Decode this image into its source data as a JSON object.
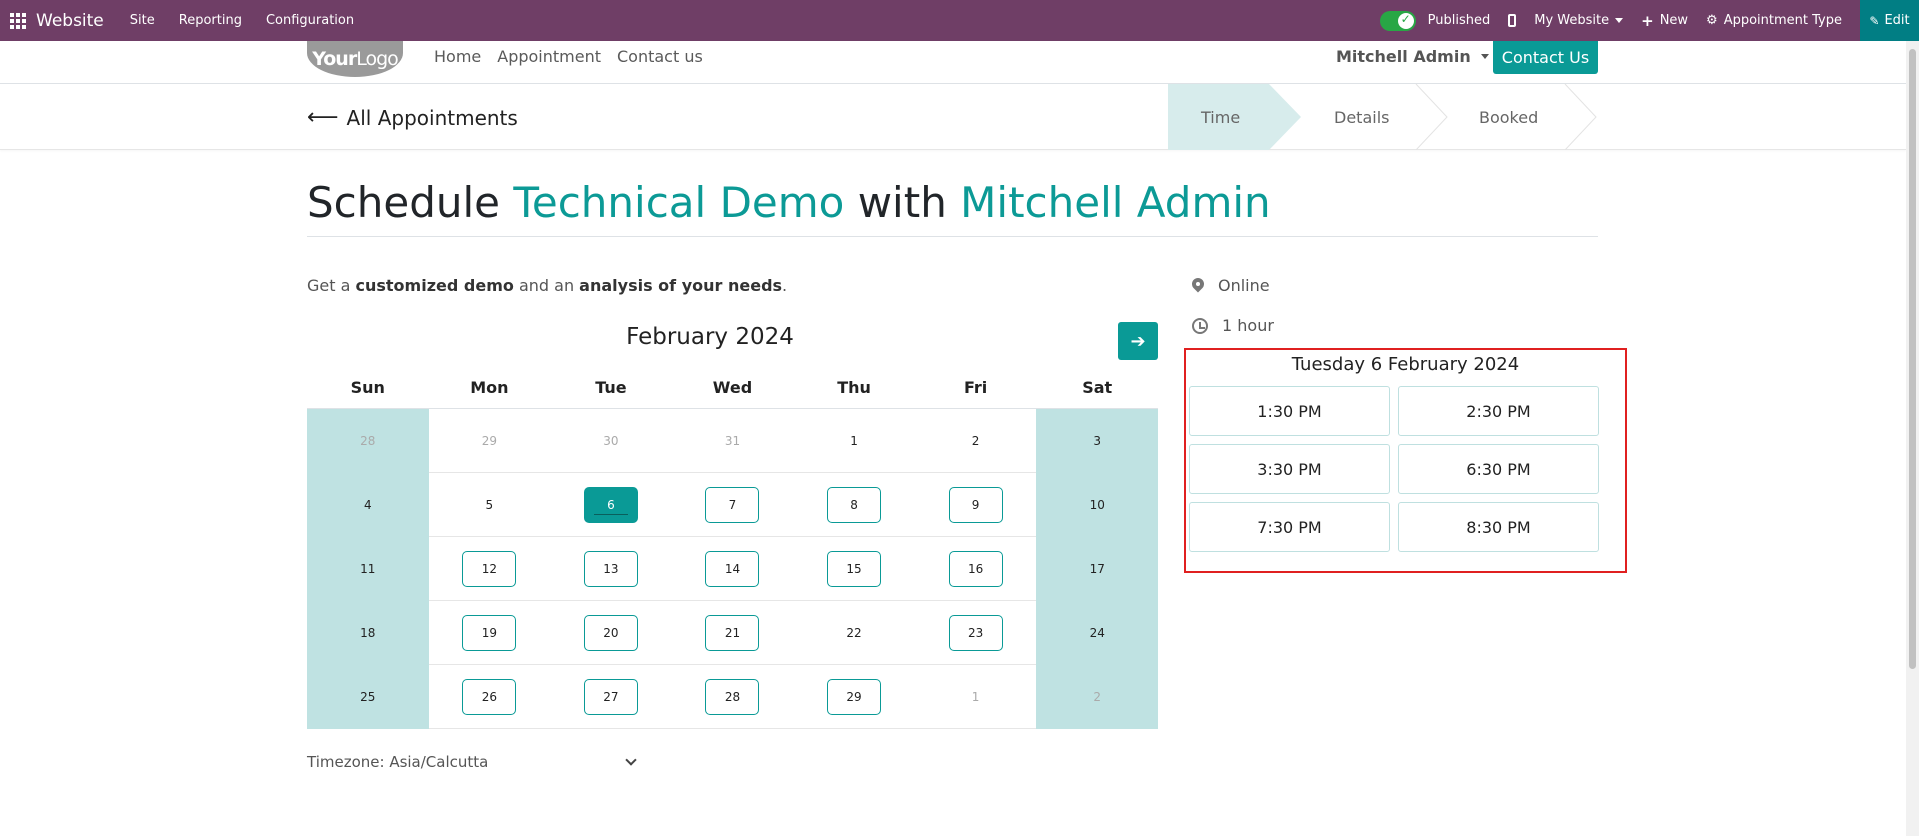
{
  "topbar": {
    "brand": "Website",
    "menus": [
      "Site",
      "Reporting",
      "Configuration"
    ],
    "published": "Published",
    "my_website": "My Website",
    "new": "New",
    "appointment_type": "Appointment Type",
    "edit": "Edit"
  },
  "header": {
    "logo_bold": "Your",
    "logo_light": "Logo",
    "nav": [
      "Home",
      "Appointment",
      "Contact us"
    ],
    "user": "Mitchell Admin",
    "contact_button": "Contact Us"
  },
  "subheader": {
    "back_label": "All Appointments",
    "steps": [
      "Time",
      "Details",
      "Booked"
    ],
    "active_step": 0
  },
  "main": {
    "title_prefix": "Schedule ",
    "title_type": "Technical Demo",
    "title_mid": " with ",
    "title_user": "Mitchell Admin",
    "desc_1": "Get a ",
    "desc_b1": "customized demo",
    "desc_2": " and an ",
    "desc_b2": "analysis of your needs",
    "desc_3": "."
  },
  "calendar": {
    "month": "February 2024",
    "weekdays": [
      "Sun",
      "Mon",
      "Tue",
      "Wed",
      "Thu",
      "Fri",
      "Sat"
    ],
    "weeks": [
      [
        {
          "d": "28",
          "m": true
        },
        {
          "d": "29",
          "m": true
        },
        {
          "d": "30",
          "m": true
        },
        {
          "d": "31",
          "m": true
        },
        {
          "d": "1"
        },
        {
          "d": "2"
        },
        {
          "d": "3"
        }
      ],
      [
        {
          "d": "4"
        },
        {
          "d": "5"
        },
        {
          "d": "6",
          "s": true
        },
        {
          "d": "7",
          "a": true
        },
        {
          "d": "8",
          "a": true
        },
        {
          "d": "9",
          "a": true
        },
        {
          "d": "10"
        }
      ],
      [
        {
          "d": "11"
        },
        {
          "d": "12",
          "a": true
        },
        {
          "d": "13",
          "a": true
        },
        {
          "d": "14",
          "a": true
        },
        {
          "d": "15",
          "a": true
        },
        {
          "d": "16",
          "a": true
        },
        {
          "d": "17"
        }
      ],
      [
        {
          "d": "18"
        },
        {
          "d": "19",
          "a": true
        },
        {
          "d": "20",
          "a": true
        },
        {
          "d": "21",
          "a": true
        },
        {
          "d": "22"
        },
        {
          "d": "23",
          "a": true
        },
        {
          "d": "24"
        }
      ],
      [
        {
          "d": "25"
        },
        {
          "d": "26",
          "a": true
        },
        {
          "d": "27",
          "a": true
        },
        {
          "d": "28",
          "a": true
        },
        {
          "d": "29",
          "a": true
        },
        {
          "d": "1",
          "m": true
        },
        {
          "d": "2",
          "m": true
        }
      ]
    ],
    "timezone": "Timezone: Asia/Calcutta"
  },
  "info": {
    "location": "Online",
    "duration": "1 hour"
  },
  "slots": {
    "date": "Tuesday 6 February 2024",
    "times": [
      "1:30 PM",
      "2:30 PM",
      "3:30 PM",
      "6:30 PM",
      "7:30 PM",
      "8:30 PM"
    ]
  },
  "colors": {
    "topbar": "#6f3e66",
    "accent": "#0a9a96",
    "weekend": "#bfe2e2",
    "highlight_border": "#e02020"
  }
}
